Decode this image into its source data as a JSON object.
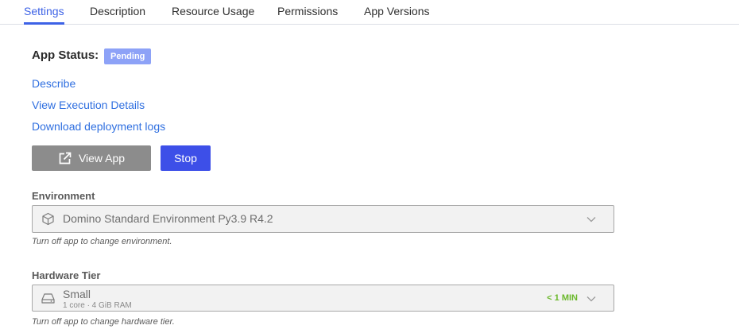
{
  "tabs": [
    {
      "label": "Settings",
      "active": true
    },
    {
      "label": "Description",
      "active": false
    },
    {
      "label": "Resource Usage",
      "active": false
    },
    {
      "label": "Permissions",
      "active": false
    },
    {
      "label": "App Versions",
      "active": false
    }
  ],
  "app_status": {
    "label": "App Status:",
    "badge": "Pending",
    "badge_color": "#8da2f7"
  },
  "links": {
    "describe": "Describe",
    "view_execution_details": "View Execution Details",
    "download_logs": "Download deployment logs"
  },
  "buttons": {
    "view_app": "View App",
    "view_app_icon": "external-link-icon",
    "stop": "Stop"
  },
  "environment": {
    "label": "Environment",
    "value": "Domino Standard Environment Py3.9 R4.2",
    "icon": "cube-icon",
    "hint": "Turn off app to change environment."
  },
  "hardware": {
    "label": "Hardware Tier",
    "name": "Small",
    "specs": "1 core · 4 GiB RAM",
    "time": "< 1 MIN",
    "icon": "hard-drive-icon",
    "hint": "Turn off app to change hardware tier."
  },
  "colors": {
    "accent": "#3d62e6",
    "link": "#2f6fe0",
    "stop_button": "#3d4fe8",
    "view_button": "#8c8c8c",
    "time_green": "#6ab82a"
  }
}
